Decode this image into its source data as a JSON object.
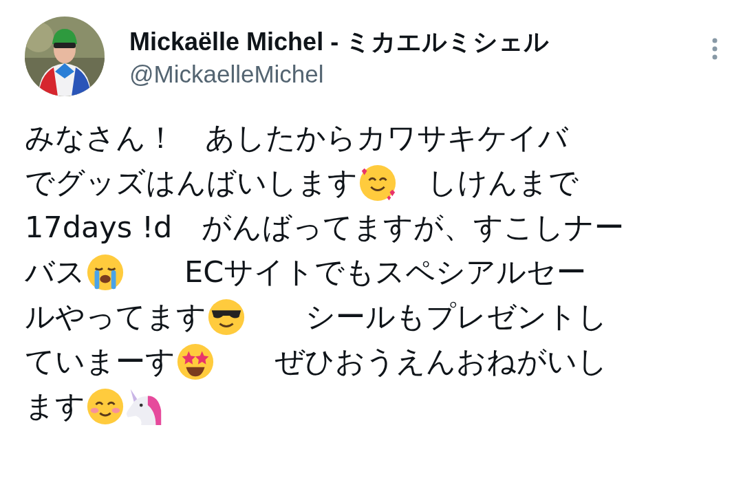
{
  "author": {
    "name": "Mickaëlle Michel - ミカエルミシェル",
    "handle": "@MickaelleMichel"
  },
  "body": {
    "lines": [
      [
        {
          "kind": "text",
          "text": "みなさん！　あしたからカワサキケイバ"
        }
      ],
      [
        {
          "kind": "text",
          "text": "でグッズはんばいします"
        },
        {
          "kind": "hearts"
        },
        {
          "kind": "text",
          "text": "　しけんまで"
        }
      ],
      [
        {
          "kind": "text",
          "text": "17days !d　がんばってますが、すこしナー"
        }
      ],
      [
        {
          "kind": "text",
          "text": "バス"
        },
        {
          "kind": "crying"
        },
        {
          "kind": "text",
          "text": "　　ECサイトでもスペシアルセー"
        }
      ],
      [
        {
          "kind": "text",
          "text": "ルやってます"
        },
        {
          "kind": "sunglasses"
        },
        {
          "kind": "text",
          "text": "　　シールもプレゼントし"
        }
      ],
      [
        {
          "kind": "text",
          "text": "ていまーす"
        },
        {
          "kind": "stareyes"
        },
        {
          "kind": "text",
          "text": "　　ぜひおうえんおねがいし"
        }
      ],
      [
        {
          "kind": "text",
          "text": "ます"
        },
        {
          "kind": "smile"
        },
        {
          "kind": "unicorn"
        }
      ]
    ]
  }
}
